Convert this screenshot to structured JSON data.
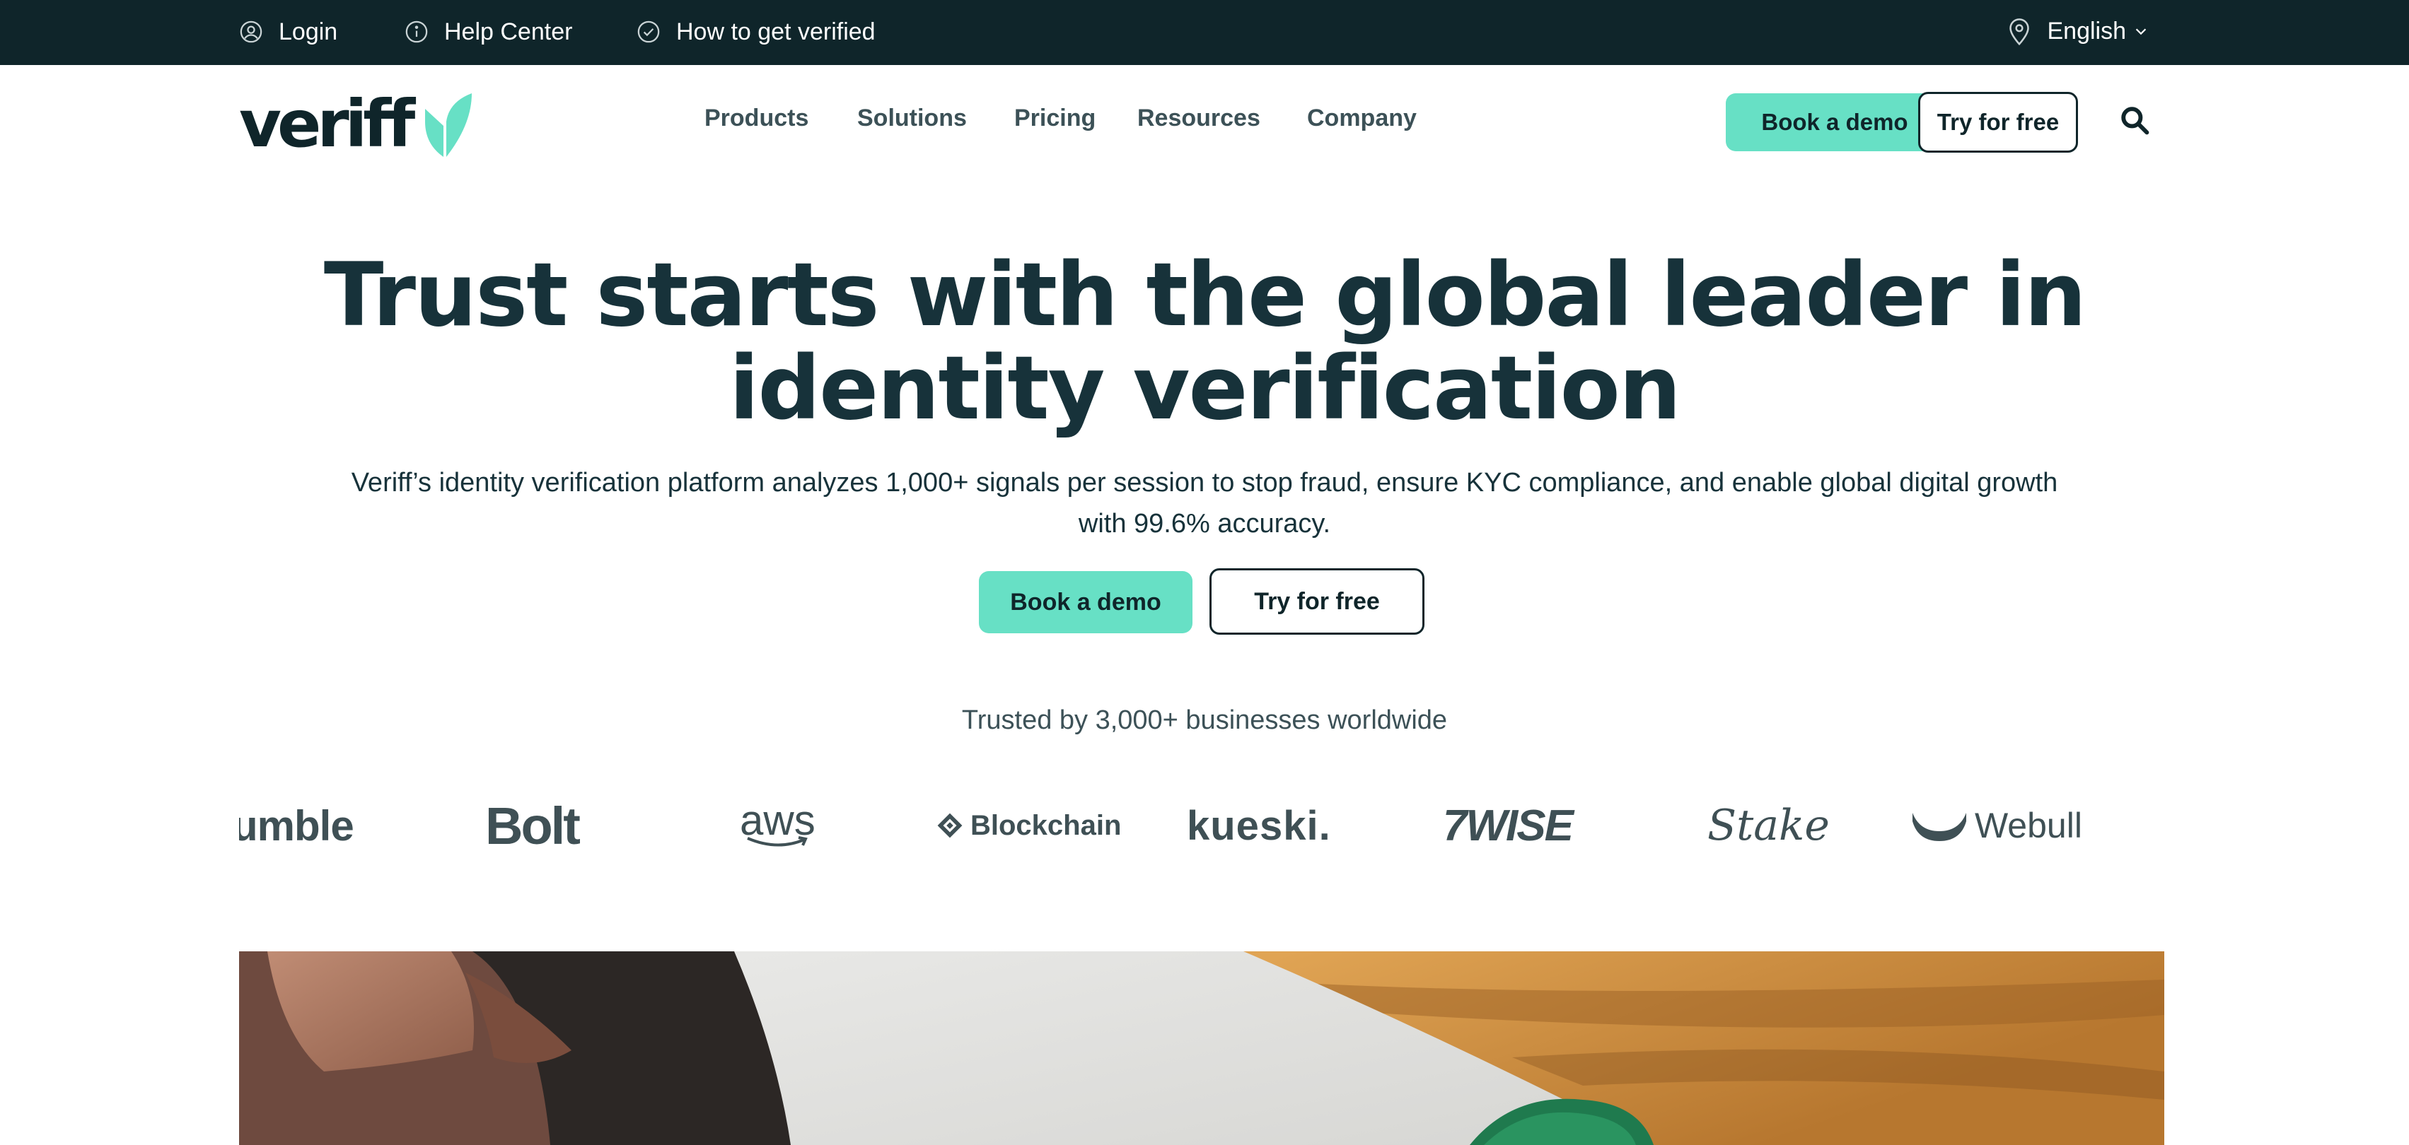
{
  "topbar": {
    "login": "Login",
    "help_center": "Help Center",
    "get_verified": "How to get verified",
    "language": "English"
  },
  "nav": {
    "logo": "veriff",
    "items": [
      "Products",
      "Solutions",
      "Pricing",
      "Resources",
      "Company"
    ],
    "book_demo": "Book a demo",
    "try_free": "Try for free"
  },
  "hero": {
    "title_line1": "Trust starts with the global leader in",
    "title_line2": "identity verification",
    "subtitle_line1": "Veriff’s identity verification platform analyzes 1,000+ signals per session to stop fraud, ensure KYC compliance, and enable global digital growth",
    "subtitle_line2": "with 99.6% accuracy.",
    "book_demo": "Book a demo",
    "try_free": "Try for free"
  },
  "trusted": {
    "text": "Trusted by 3,000+ businesses worldwide",
    "logos": [
      "umble",
      "Bolt",
      "aws",
      "Blockchain",
      "kueski.",
      "7WISE",
      "Stake",
      "Webull"
    ]
  },
  "colors": {
    "topbar_bg": "#0f252a",
    "accent": "#67e0c5",
    "text_dark": "#17323a",
    "logo_gray": "#3f5055"
  },
  "icons": [
    "user-icon",
    "info-icon",
    "check-circle-icon",
    "location-pin-icon",
    "chevron-down-icon",
    "search-icon"
  ]
}
